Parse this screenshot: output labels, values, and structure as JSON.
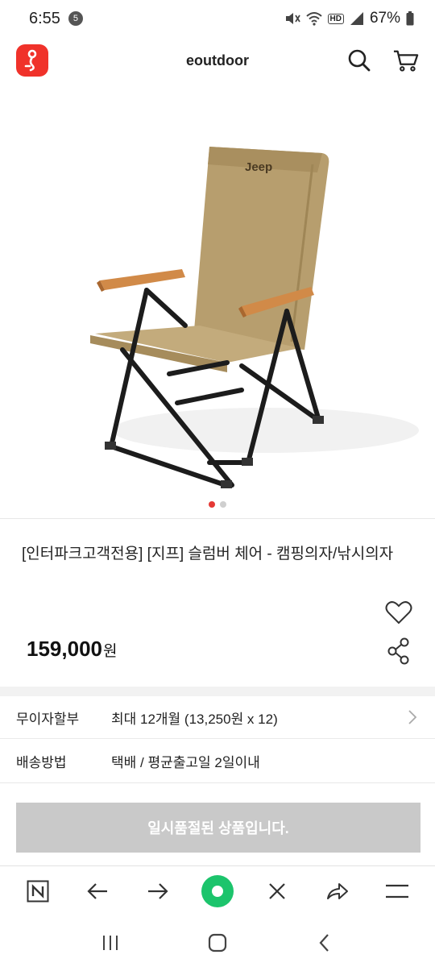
{
  "status_bar": {
    "time": "6:55",
    "notification_count": "5",
    "hd": "HD",
    "battery_percent": "67%"
  },
  "header": {
    "site_name": "eoutdoor"
  },
  "gallery": {
    "image_count": 2,
    "active_index": 0,
    "brand_print": "Jeep"
  },
  "product": {
    "title": "[인터파크고객전용] [지프] 슬럼버 체어 - 캠핑의자/낚시의자",
    "price": "159,000",
    "price_unit": "원"
  },
  "info": {
    "installment_label": "무이자할부",
    "installment_value": "최대 12개월 (13,250원 x 12)",
    "shipping_label": "배송방법",
    "shipping_value": "택배 / 평균출고일 2일이내"
  },
  "cta": {
    "soldout_label": "일시품절된 상품입니다."
  },
  "colors": {
    "brand_red": "#f0322a",
    "soldout_gray": "#c9c9c9",
    "home_green": "#1cc46c",
    "active_dot": "#e53935"
  }
}
